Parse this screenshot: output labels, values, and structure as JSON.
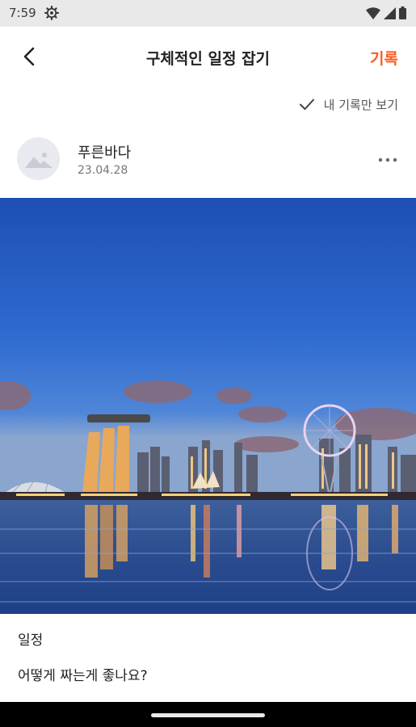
{
  "status_bar": {
    "time": "7:59",
    "icons": [
      "settings-gear-icon",
      "wifi-icon",
      "cellular-signal-icon",
      "battery-icon"
    ]
  },
  "app_bar": {
    "title": "구체적인 일정 잡기",
    "action_label": "기록",
    "action_color": "#ff5a1f"
  },
  "filter": {
    "label": "내 기록만 보기",
    "checked": true
  },
  "post": {
    "author": "푸른바다",
    "date": "23.04.28",
    "photo": "singapore-marina-bay-skyline-photo",
    "category": "일정",
    "text": "어떻게 짜는게 좋나요?"
  }
}
